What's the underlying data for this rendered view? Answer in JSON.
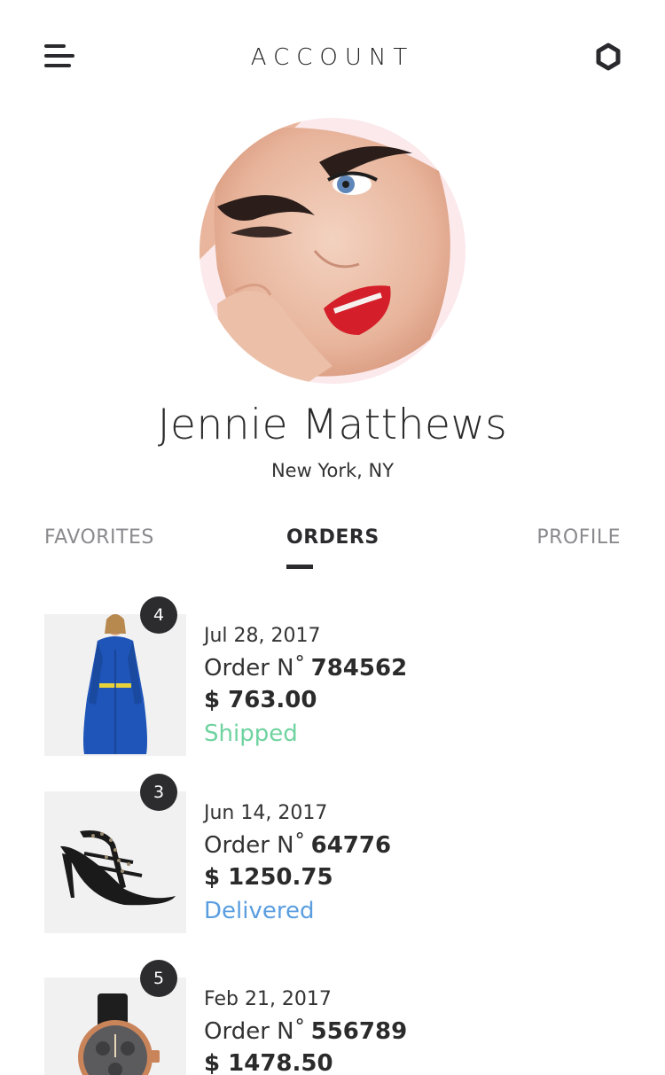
{
  "header": {
    "title": "ACCOUNT"
  },
  "icons": {
    "menu": "menu-icon",
    "settings": "gear-icon"
  },
  "user": {
    "name": "Jennie Matthews",
    "location": "New York, NY"
  },
  "tabs": [
    {
      "label": "FAVORITES",
      "active": false
    },
    {
      "label": "ORDERS",
      "active": true
    },
    {
      "label": "PROFILE",
      "active": false
    }
  ],
  "order_prefix": "Order N˚",
  "orders": [
    {
      "badge": "4",
      "date": "Jul 28, 2017",
      "number": "784562",
      "price": "$ 763.00",
      "status": "Shipped",
      "status_color": "#6fd3a0",
      "product": "blue coat"
    },
    {
      "badge": "3",
      "date": "Jun 14, 2017",
      "number": "64776",
      "price": "$ 1250.75",
      "status": "Delivered",
      "status_color": "#5a9ee0",
      "product": "black studded heels"
    },
    {
      "badge": "5",
      "date": "Feb 21, 2017",
      "number": "556789",
      "price": "$ 1478.50",
      "status": "",
      "status_color": "#5a9ee0",
      "product": "watch"
    }
  ],
  "colors": {
    "accent_dark": "#2b2b2e",
    "tab_inactive": "#8a8a8e",
    "shipped": "#6fd3a0",
    "delivered": "#5a9ee0"
  }
}
